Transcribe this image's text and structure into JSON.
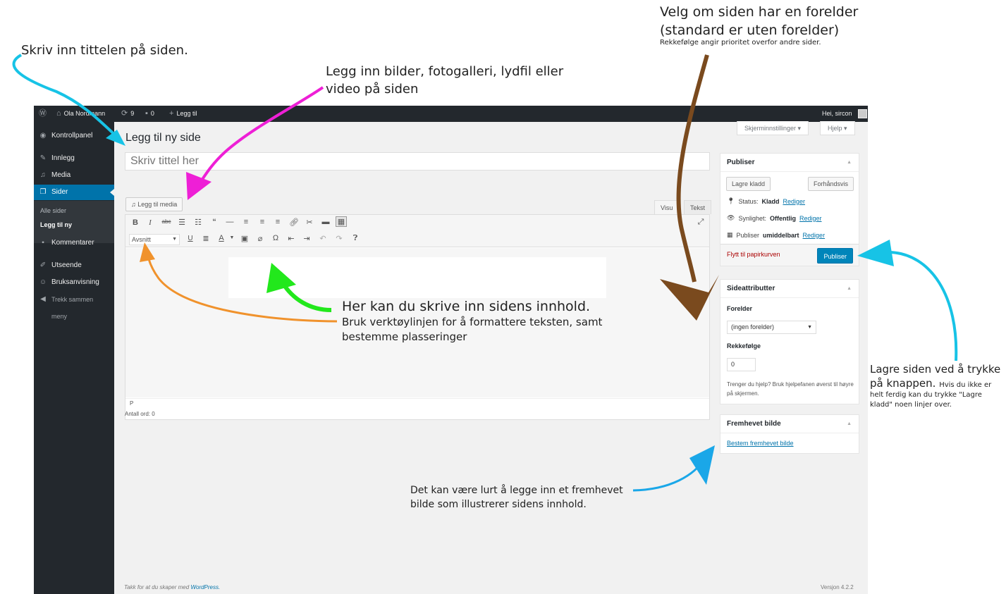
{
  "annotations": {
    "title_note": "Skriv inn tittelen på siden.",
    "media_note_1": "Legg inn bilder, fotogalleri, lydfil eller",
    "media_note_2": "video på siden",
    "parent_note_1": "Velg om siden har en forelder",
    "parent_note_2": "(standard er uten forelder)",
    "parent_note_3": "Rekkefølge angir prioritet overfor andre sider.",
    "content_note_1": "Her kan du skrive inn sidens innhold.",
    "content_note_2": "Bruk verktøylinjen for å formattere teksten, samt",
    "content_note_3": "bestemme plasseringer",
    "publish_note_1": "Lagre siden ved å trykke",
    "publish_note_2a": "på knappen.",
    "publish_note_2b": "Hvis du ikke er",
    "publish_note_3": "helt ferdig kan du trykke \"Lagre",
    "publish_note_4": "kladd\"  noen linjer over.",
    "featured_note_1": "Det kan være lurt å legge inn et fremhevet",
    "featured_note_2": "bilde som illustrerer sidens innhold.",
    "colors": {
      "cyan": "#17c3e6",
      "magenta": "#ee1fd6",
      "brown": "#7a4a1e",
      "green": "#22e81c",
      "orange": "#f0922c",
      "blue": "#1aa7e8"
    }
  },
  "adminbar": {
    "site_name": "Ola Nordmann",
    "updates_count": "9",
    "comments_count": "0",
    "new_label": "Legg til",
    "greeting": "Hei, sircon"
  },
  "sidebar": {
    "items": [
      {
        "label": "Kontrollpanel",
        "icon": "dashboard-icon"
      },
      {
        "label": "Innlegg",
        "icon": "pin-icon"
      },
      {
        "label": "Media",
        "icon": "media-icon"
      },
      {
        "label": "Sider",
        "icon": "pages-icon"
      },
      {
        "label": "Kommentarer",
        "icon": "comments-icon"
      },
      {
        "label": "Utseende",
        "icon": "appearance-icon"
      },
      {
        "label": "Bruksanvisning",
        "icon": "smiley-icon"
      },
      {
        "label": "Trekk sammen",
        "icon": "collapse-icon"
      },
      {
        "label": "meny"
      }
    ],
    "submenu": [
      "Alle sider",
      "Legg til ny"
    ]
  },
  "main": {
    "page_title": "Legg til ny side",
    "screen_options": "Skjerminnstillinger",
    "help": "Hjelp",
    "title_placeholder": "Skriv tittel her",
    "add_media": "Legg til media",
    "tab_visual": "Visu",
    "tab_text": "Tekst",
    "format_select": "Avsnitt",
    "path": "P",
    "word_count": "Antall ord: 0"
  },
  "publish_box": {
    "title": "Publiser",
    "save_draft": "Lagre kladd",
    "preview": "Forhåndsvis",
    "status_label": "Status:",
    "status_value": "Kladd",
    "visibility_label": "Synlighet:",
    "visibility_value": "Offentlig",
    "publish_label": "Publiser",
    "publish_value": "umiddelbart",
    "edit_link": "Rediger",
    "trash": "Flytt til papirkurven",
    "publish_button": "Publiser"
  },
  "attributes_box": {
    "title": "Sideattributter",
    "parent_label": "Forelder",
    "parent_value": "(ingen forelder)",
    "order_label": "Rekkefølge",
    "order_value": "0",
    "help_text": "Trenger du hjelp? Bruk hjelpefanen øverst til høyre på skjermen."
  },
  "featured_box": {
    "title": "Fremhevet bilde",
    "link": "Bestem fremhevet bilde"
  },
  "footer": {
    "thanks": "Takk for at du skaper med",
    "wordpress": "WordPress.",
    "version": "Versjon 4.2.2"
  }
}
